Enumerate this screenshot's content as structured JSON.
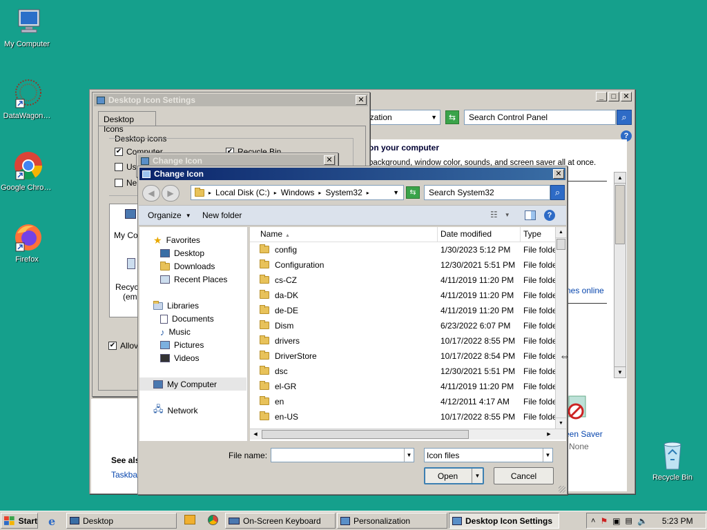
{
  "desktop": {
    "icons": [
      {
        "label": "My Computer"
      },
      {
        "label": "DataWagon…"
      },
      {
        "label": "Google Chrome"
      },
      {
        "label": "Firefox"
      },
      {
        "label": "Recycle Bin"
      }
    ]
  },
  "personalization": {
    "address_tail": "ization",
    "search_placeholder": "Search Control Panel",
    "heading": "on your computer",
    "subtext": "background, window color, sounds, and screen saver all at once.",
    "link_online": "nes online",
    "screen_saver_label": "een Saver",
    "screen_saver_value": "None",
    "see_also": "See als",
    "taskbar_link": "Taskbar"
  },
  "desktop_icon_settings": {
    "title": "Desktop Icon Settings",
    "tab": "Desktop Icons",
    "group_label": "Desktop icons",
    "checkboxes": [
      "Computer",
      "Recycle Bin",
      "Us",
      "Ne"
    ],
    "icon_label_1": "My Co",
    "icon_label_2": "Recyc",
    "icon_label_3": "(emp",
    "allow_label": "Allov"
  },
  "change_icon_back": {
    "title": "Change Icon"
  },
  "change_icon": {
    "title": "Change Icon",
    "breadcrumb": [
      "Local Disk (C:)",
      "Windows",
      "System32"
    ],
    "search_placeholder": "Search System32",
    "organize_label": "Organize",
    "new_folder_label": "New folder",
    "nav": {
      "favorites": "Favorites",
      "desktop": "Desktop",
      "downloads": "Downloads",
      "recent": "Recent Places",
      "libraries": "Libraries",
      "documents": "Documents",
      "music": "Music",
      "pictures": "Pictures",
      "videos": "Videos",
      "my_computer": "My Computer",
      "network": "Network"
    },
    "columns": {
      "name": "Name",
      "date": "Date modified",
      "type": "Type"
    },
    "rows": [
      {
        "name": "config",
        "date": "1/30/2023 5:12 PM",
        "type": "File folder"
      },
      {
        "name": "Configuration",
        "date": "12/30/2021 5:51 PM",
        "type": "File folder"
      },
      {
        "name": "cs-CZ",
        "date": "4/11/2019 11:20 PM",
        "type": "File folder"
      },
      {
        "name": "da-DK",
        "date": "4/11/2019 11:20 PM",
        "type": "File folder"
      },
      {
        "name": "de-DE",
        "date": "4/11/2019 11:20 PM",
        "type": "File folder"
      },
      {
        "name": "Dism",
        "date": "6/23/2022 6:07 PM",
        "type": "File folder"
      },
      {
        "name": "drivers",
        "date": "10/17/2022 8:55 PM",
        "type": "File folder"
      },
      {
        "name": "DriverStore",
        "date": "10/17/2022 8:54 PM",
        "type": "File folder"
      },
      {
        "name": "dsc",
        "date": "12/30/2021 5:51 PM",
        "type": "File folder"
      },
      {
        "name": "el-GR",
        "date": "4/11/2019 11:20 PM",
        "type": "File folder"
      },
      {
        "name": "en",
        "date": "4/12/2011 4:17 AM",
        "type": "File folder"
      },
      {
        "name": "en-US",
        "date": "10/17/2022 8:55 PM",
        "type": "File folder"
      }
    ],
    "file_name_label": "File name:",
    "file_name_value": "",
    "file_type_value": "Icon files",
    "open_label": "Open",
    "cancel_label": "Cancel"
  },
  "taskbar": {
    "start_label": "Start",
    "items": [
      {
        "label": "Desktop"
      },
      {
        "label": "On-Screen Keyboard"
      },
      {
        "label": "Personalization"
      },
      {
        "label": "Desktop Icon Settings"
      }
    ],
    "clock": "5:23 PM"
  },
  "colors": {
    "desktop_bg": "#15a08c",
    "title_active": "#0a246a",
    "title_inactive": "#b8b6b0",
    "selection": "#cce8ff"
  }
}
